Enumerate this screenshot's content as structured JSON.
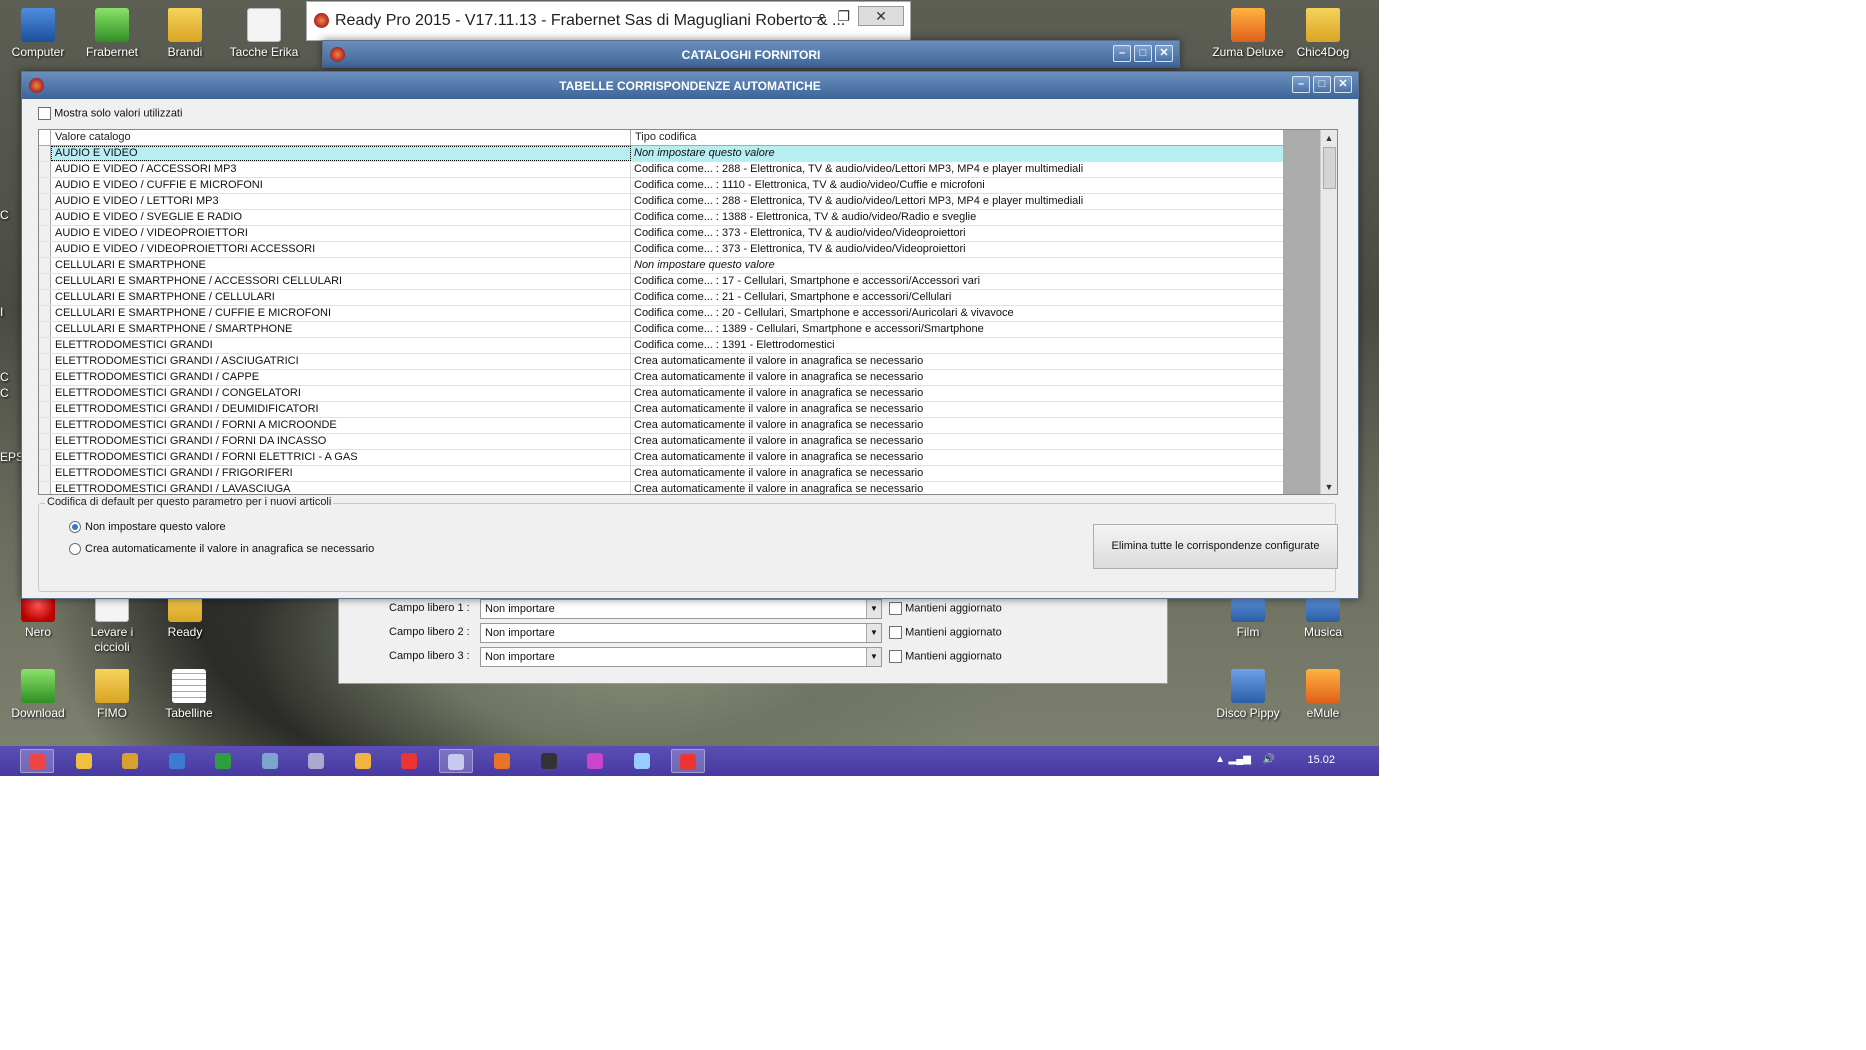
{
  "desktop": {
    "icons_left": [
      {
        "label": "Computer",
        "kind": "pc"
      },
      {
        "label": "Frabernet",
        "kind": "green"
      },
      {
        "label": "Brandi",
        "kind": "folder"
      },
      {
        "label": "Tacche Erika",
        "kind": "doc"
      }
    ],
    "icons_right": [
      {
        "label": "Zuma Deluxe",
        "kind": "orange"
      },
      {
        "label": "Chic4Dog",
        "kind": "folder"
      }
    ],
    "icons_lower_left": [
      {
        "label": "Nero",
        "kind": "red"
      },
      {
        "label": "Levare i ciccioli",
        "kind": "doc"
      },
      {
        "label": "Ready",
        "kind": "folder"
      },
      {
        "label": "Download",
        "kind": "green"
      },
      {
        "label": "FIMO",
        "kind": "folder"
      },
      {
        "label": "Tabelline",
        "kind": "grid"
      }
    ],
    "icons_lower_right": [
      {
        "label": "Film",
        "kind": "blue"
      },
      {
        "label": "Musica",
        "kind": "blue"
      },
      {
        "label": "Disco Pippy",
        "kind": "blue"
      },
      {
        "label": "eMule",
        "kind": "orange"
      }
    ],
    "partial_left_text": [
      "C",
      "I",
      "C",
      "C",
      "EPS"
    ]
  },
  "main_window": {
    "title": "Ready Pro 2015 - V17.11.13 - Frabernet Sas di Magugliani Roberto & ...",
    "minimize": "—",
    "restore": "❐",
    "close": "✕"
  },
  "catalog_window": {
    "title": "CATALOGHI FORNITORI"
  },
  "dialog": {
    "title": "TABELLE CORRISPONDENZE AUTOMATICHE",
    "show_used_label": "Mostra solo valori utilizzati",
    "columns": [
      "Valore catalogo",
      "Tipo codifica"
    ],
    "rows": [
      {
        "valore": "AUDIO E VIDEO",
        "tipo": "Non impostare questo valore",
        "italic": true,
        "selected": true
      },
      {
        "valore": "AUDIO E VIDEO / ACCESSORI MP3",
        "tipo": "Codifica come... : 288 - Elettronica, TV & audio/video/Lettori MP3, MP4 e player multimediali"
      },
      {
        "valore": "AUDIO E VIDEO / CUFFIE E MICROFONI",
        "tipo": "Codifica come... : 1110 - Elettronica, TV & audio/video/Cuffie e microfoni"
      },
      {
        "valore": "AUDIO E VIDEO / LETTORI MP3",
        "tipo": "Codifica come... : 288 - Elettronica, TV & audio/video/Lettori MP3, MP4 e player multimediali"
      },
      {
        "valore": "AUDIO E VIDEO / SVEGLIE E RADIO",
        "tipo": "Codifica come... : 1388 - Elettronica, TV & audio/video/Radio e sveglie"
      },
      {
        "valore": "AUDIO E VIDEO / VIDEOPROIETTORI",
        "tipo": "Codifica come... : 373 - Elettronica, TV & audio/video/Videoproiettori"
      },
      {
        "valore": "AUDIO E VIDEO / VIDEOPROIETTORI ACCESSORI",
        "tipo": "Codifica come... : 373 - Elettronica, TV & audio/video/Videoproiettori"
      },
      {
        "valore": "CELLULARI E SMARTPHONE",
        "tipo": "Non impostare questo valore",
        "italic": true
      },
      {
        "valore": "CELLULARI E SMARTPHONE / ACCESSORI CELLULARI",
        "tipo": "Codifica come... : 17 - Cellulari, Smartphone e accessori/Accessori vari"
      },
      {
        "valore": "CELLULARI E SMARTPHONE / CELLULARI",
        "tipo": "Codifica come... : 21 - Cellulari, Smartphone e accessori/Cellulari"
      },
      {
        "valore": "CELLULARI E SMARTPHONE / CUFFIE E MICROFONI",
        "tipo": "Codifica come... : 20 - Cellulari, Smartphone e accessori/Auricolari & vivavoce"
      },
      {
        "valore": "CELLULARI E SMARTPHONE / SMARTPHONE",
        "tipo": "Codifica come... : 1389 - Cellulari, Smartphone e accessori/Smartphone"
      },
      {
        "valore": "ELETTRODOMESTICI GRANDI",
        "tipo": "Codifica come... : 1391 - Elettrodomestici"
      },
      {
        "valore": "ELETTRODOMESTICI GRANDI / ASCIUGATRICI",
        "tipo": "Crea automaticamente il valore in anagrafica se necessario"
      },
      {
        "valore": "ELETTRODOMESTICI GRANDI / CAPPE",
        "tipo": "Crea automaticamente il valore in anagrafica se necessario"
      },
      {
        "valore": "ELETTRODOMESTICI GRANDI / CONGELATORI",
        "tipo": "Crea automaticamente il valore in anagrafica se necessario"
      },
      {
        "valore": "ELETTRODOMESTICI GRANDI / DEUMIDIFICATORI",
        "tipo": "Crea automaticamente il valore in anagrafica se necessario"
      },
      {
        "valore": "ELETTRODOMESTICI GRANDI / FORNI A MICROONDE",
        "tipo": "Crea automaticamente il valore in anagrafica se necessario"
      },
      {
        "valore": "ELETTRODOMESTICI GRANDI / FORNI DA INCASSO",
        "tipo": "Crea automaticamente il valore in anagrafica se necessario"
      },
      {
        "valore": "ELETTRODOMESTICI GRANDI / FORNI ELETTRICI - A GAS",
        "tipo": "Crea automaticamente il valore in anagrafica se necessario"
      },
      {
        "valore": "ELETTRODOMESTICI GRANDI / FRIGORIFERI",
        "tipo": "Crea automaticamente il valore in anagrafica se necessario"
      },
      {
        "valore": "ELETTRODOMESTICI GRANDI / LAVASCIUGA",
        "tipo": "Crea automaticamente il valore in anagrafica se necessario"
      }
    ],
    "default_group_label": "Codifica di default per questo parametro per i nuovi articoli",
    "radio_options": [
      {
        "label": "Non impostare questo valore",
        "checked": true
      },
      {
        "label": "Crea automaticamente il valore in anagrafica se necessario",
        "checked": false
      }
    ],
    "delete_all_button": "Elimina tutte le corrispondenze configurate"
  },
  "campi_liberi": [
    {
      "label": "Campo libero 1 :",
      "value": "Non importare",
      "keep": "Mantieni aggiornato"
    },
    {
      "label": "Campo libero 2 :",
      "value": "Non importare",
      "keep": "Mantieni aggiornato"
    },
    {
      "label": "Campo libero 3 :",
      "value": "Non importare",
      "keep": "Mantieni aggiornato"
    }
  ],
  "taskbar": {
    "clock": "15.02",
    "app_count": 15
  },
  "colors": {
    "selected_row": "#b8eef2",
    "titlebar": "#4a72a6",
    "taskbar": "#4f43ac"
  }
}
